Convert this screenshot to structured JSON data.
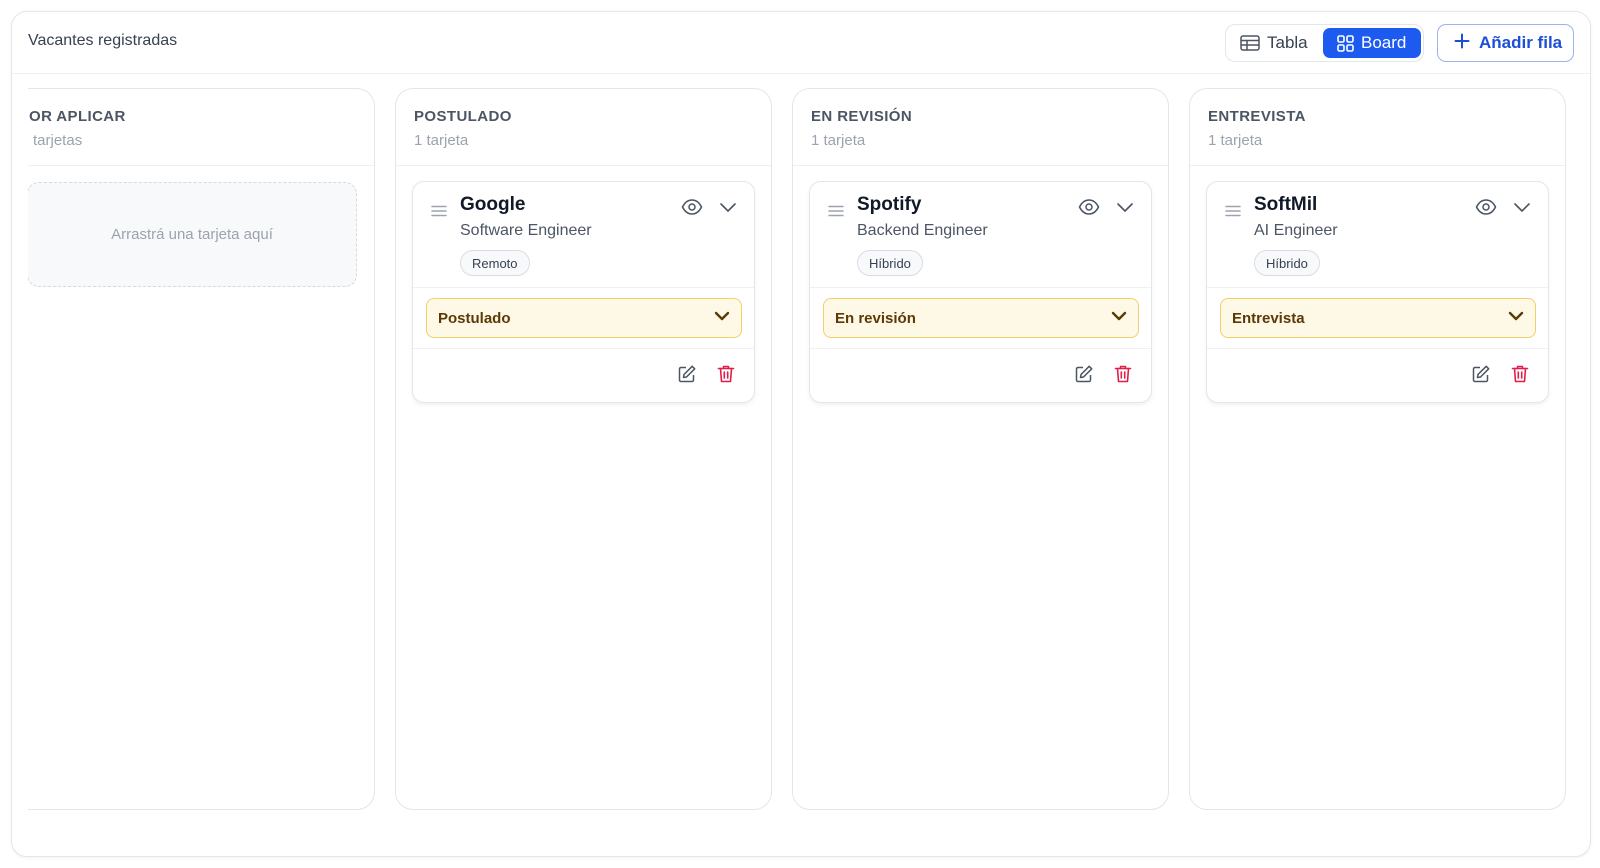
{
  "header": {
    "title": "Vacantes registradas",
    "view_tabla": "Tabla",
    "view_board": "Board",
    "add_row": "Añadir fila"
  },
  "columns": [
    {
      "title": "OR APLICAR",
      "count": "tarjetas",
      "empty_text": "Arrastrá una tarjeta aquí"
    },
    {
      "title": "POSTULADO",
      "count": "1 tarjeta",
      "card": {
        "company": "Google",
        "role": "Software Engineer",
        "tag": "Remoto",
        "status": "Postulado"
      }
    },
    {
      "title": "EN REVISIÓN",
      "count": "1 tarjeta",
      "card": {
        "company": "Spotify",
        "role": "Backend Engineer",
        "tag": "Híbrido",
        "status": "En revisión"
      }
    },
    {
      "title": "ENTREVISTA",
      "count": "1 tarjeta",
      "card": {
        "company": "SoftMil",
        "role": "AI Engineer",
        "tag": "Híbrido",
        "status": "Entrevista"
      }
    }
  ],
  "colors": {
    "accent": "#1d5bf0",
    "status_border": "#f2cf6a",
    "status_bg": "#fef8e6",
    "delete": "#e11d48"
  }
}
